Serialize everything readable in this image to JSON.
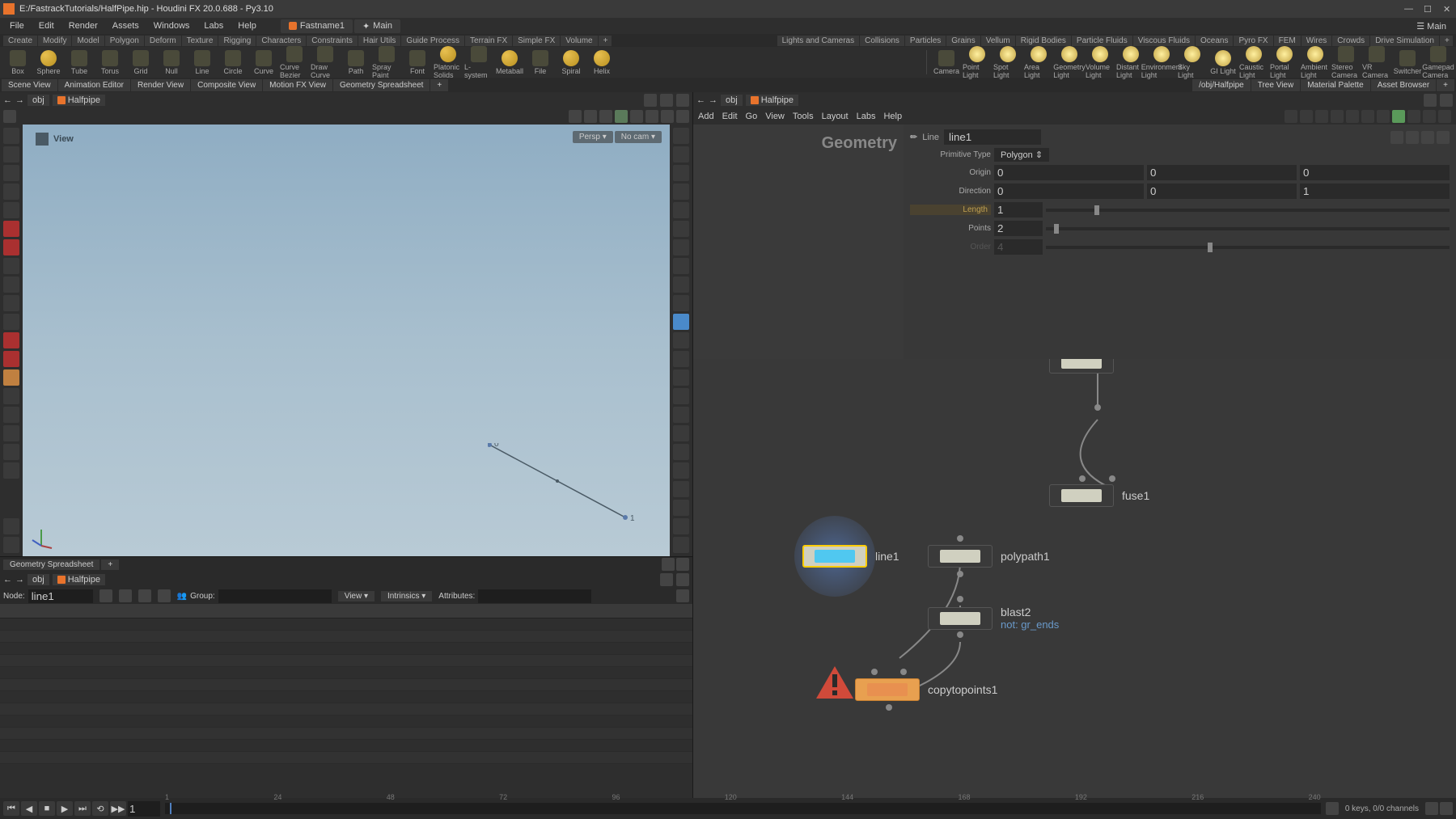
{
  "window": {
    "title": "E:/FastrackTutorials/HalfPipe.hip - Houdini FX 20.0.688 - Py3.10"
  },
  "menubar": {
    "items": [
      "File",
      "Edit",
      "Render",
      "Assets",
      "Windows",
      "Labs",
      "Help"
    ],
    "tabs": [
      "Fastname1",
      "Main"
    ],
    "right_main": "Main"
  },
  "shelf_tabs_left": [
    "Create",
    "Modify",
    "Model",
    "Polygon",
    "Deform",
    "Texture",
    "Rigging",
    "Characters",
    "Constraints",
    "Hair Utils",
    "Guide Process",
    "Terrain FX",
    "Simple FX",
    "Volume"
  ],
  "shelf_tabs_right": [
    "Lights and Cameras",
    "Collisions",
    "Particles",
    "Grains",
    "Vellum",
    "Rigid Bodies",
    "Particle Fluids",
    "Viscous Fluids",
    "Oceans",
    "Pyro FX",
    "FEM",
    "Wires",
    "Crowds",
    "Drive Simulation"
  ],
  "shelf_left": [
    "Box",
    "Sphere",
    "Tube",
    "Torus",
    "Grid",
    "Null",
    "Line",
    "Circle",
    "Curve",
    "Curve Bezier",
    "Draw Curve",
    "Path",
    "Spray Paint",
    "Font",
    "Platonic Solids",
    "L-system",
    "Metaball",
    "File",
    "Spiral",
    "Helix"
  ],
  "shelf_right": [
    "Camera",
    "Point Light",
    "Spot Light",
    "Area Light",
    "Geometry Light",
    "Volume Light",
    "Distant Light",
    "Environment Light",
    "Sky Light",
    "GI Light",
    "Caustic Light",
    "Portal Light",
    "Ambient Light",
    "Stereo Camera",
    "VR Camera",
    "Switcher",
    "Gamepad Camera"
  ],
  "panes_left": [
    "Scene View",
    "Animation Editor",
    "Render View",
    "Composite View",
    "Motion FX View",
    "Geometry Spreadsheet"
  ],
  "panes_right": [
    "/obj/Halfpipe",
    "Tree View",
    "Material Palette",
    "Asset Browser"
  ],
  "viewport": {
    "path": [
      "obj",
      "Halfpipe"
    ],
    "view_label": "View",
    "persp": "Persp ▾",
    "no_cam": "No cam ▾"
  },
  "spreadsheet": {
    "tab": "Geometry Spreadsheet",
    "node_label": "Node:",
    "node_value": "line1",
    "group_label": "Group:",
    "view_label": "View",
    "intrinsics_label": "Intrinsics",
    "attributes_label": "Attributes:"
  },
  "network": {
    "menus": [
      "Add",
      "Edit",
      "Go",
      "View",
      "Tools",
      "Layout",
      "Labs",
      "Help"
    ],
    "path": [
      "obj",
      "Halfpipe"
    ],
    "geometry_header": "Geometry",
    "nodes": {
      "fuse1": "fuse1",
      "line1": "line1",
      "polypath1": "polypath1",
      "blast2": "blast2",
      "blast2_sub": "not: gr_ends",
      "copytopoints1": "copytopoints1"
    }
  },
  "params": {
    "node_type": "Line",
    "node_name": "line1",
    "primitive_type_label": "Primitive Type",
    "primitive_type_value": "Polygon",
    "origin_label": "Origin",
    "origin": [
      "0",
      "0",
      "0"
    ],
    "direction_label": "Direction",
    "direction": [
      "0",
      "0",
      "1"
    ],
    "length_label": "Length",
    "length_value": "1",
    "points_label": "Points",
    "points_value": "2",
    "order_label": "Order",
    "order_value": "4"
  },
  "timeline": {
    "frame": "1",
    "ticks": [
      "1",
      "24",
      "48",
      "72",
      "96",
      "120",
      "144",
      "168",
      "192",
      "216",
      "240"
    ],
    "info": "0 keys, 0/0 channels"
  }
}
